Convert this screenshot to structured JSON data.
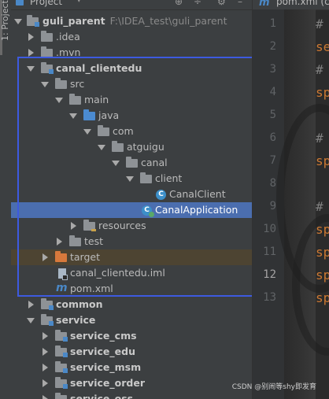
{
  "tool_window": {
    "label": "1: Project"
  },
  "panel": {
    "title": "Project",
    "caret": "▾",
    "buttons": [
      "⊕",
      "÷",
      "⚙",
      "–"
    ]
  },
  "tree": [
    {
      "text": "guli_parent",
      "path": "F:\\IDEA_test\\guli_parent",
      "icon": "module-folder-icon",
      "expanded": true,
      "bold": true
    },
    {
      "text": ".idea",
      "icon": "folder-icon",
      "expanded": false
    },
    {
      "text": ".mvn",
      "icon": "folder-icon",
      "expanded": false
    },
    {
      "text": "canal_clientedu",
      "icon": "module-folder-icon",
      "expanded": true,
      "bold": true
    },
    {
      "text": "src",
      "icon": "folder-icon",
      "expanded": true
    },
    {
      "text": "main",
      "icon": "folder-icon",
      "expanded": true
    },
    {
      "text": "java",
      "icon": "source-folder-icon",
      "expanded": true
    },
    {
      "text": "com",
      "icon": "package-icon",
      "expanded": true
    },
    {
      "text": "atguigu",
      "icon": "package-icon",
      "expanded": true
    },
    {
      "text": "canal",
      "icon": "package-icon",
      "expanded": true
    },
    {
      "text": "client",
      "icon": "package-icon",
      "expanded": true
    },
    {
      "text": "CanalClient",
      "icon": "class-icon"
    },
    {
      "text": "CanalApplication",
      "icon": "spring-boot-class-icon",
      "selected": true
    },
    {
      "text": "resources",
      "icon": "resources-folder-icon",
      "expanded": false
    },
    {
      "text": "test",
      "icon": "folder-icon",
      "expanded": false
    },
    {
      "text": "target",
      "icon": "excluded-folder-icon",
      "expanded": false
    },
    {
      "text": "canal_clientedu.iml",
      "icon": "iml-file-icon"
    },
    {
      "text": "pom.xml",
      "icon": "maven-icon"
    },
    {
      "text": "common",
      "icon": "module-folder-icon",
      "expanded": false,
      "bold": true
    },
    {
      "text": "service",
      "icon": "module-folder-icon",
      "expanded": true,
      "bold": true
    },
    {
      "text": "service_cms",
      "icon": "module-folder-icon",
      "expanded": false,
      "bold": true
    },
    {
      "text": "service_edu",
      "icon": "module-folder-icon",
      "expanded": false,
      "bold": true
    },
    {
      "text": "service_msm",
      "icon": "module-folder-icon",
      "expanded": false,
      "bold": true
    },
    {
      "text": "service_order",
      "icon": "module-folder-icon",
      "expanded": false,
      "bold": true
    },
    {
      "text": "service_oss",
      "icon": "module-folder-icon",
      "expanded": false,
      "bold": true
    }
  ],
  "editor": {
    "tab_icon": "m",
    "tab_label": "pom.xml (c",
    "line_numbers": [
      "1",
      "2",
      "3",
      "4",
      "5",
      "6",
      "7",
      "8",
      "9",
      "10",
      "11",
      "12",
      "13"
    ],
    "current_line": "12",
    "code": [
      {
        "line": "1",
        "text": "#"
      },
      {
        "line": "2",
        "text": "se"
      },
      {
        "line": "3",
        "text": "#"
      },
      {
        "line": "4",
        "text": "sp"
      },
      {
        "line": "6",
        "text": "#"
      },
      {
        "line": "7",
        "text": "sp"
      },
      {
        "line": "9",
        "text": "#"
      },
      {
        "line": "10",
        "text": "sp"
      },
      {
        "line": "11",
        "text": "sp"
      },
      {
        "line": "12",
        "text": "sp"
      },
      {
        "line": "13",
        "text": "sp"
      }
    ]
  },
  "watermark": "CSDN @别闹等shy即发育",
  "colors": {
    "selection": "#4b6eaf",
    "highlight_box": "#3d5ae0",
    "keyword": "#cc7832",
    "excluded": "#d7793c"
  }
}
